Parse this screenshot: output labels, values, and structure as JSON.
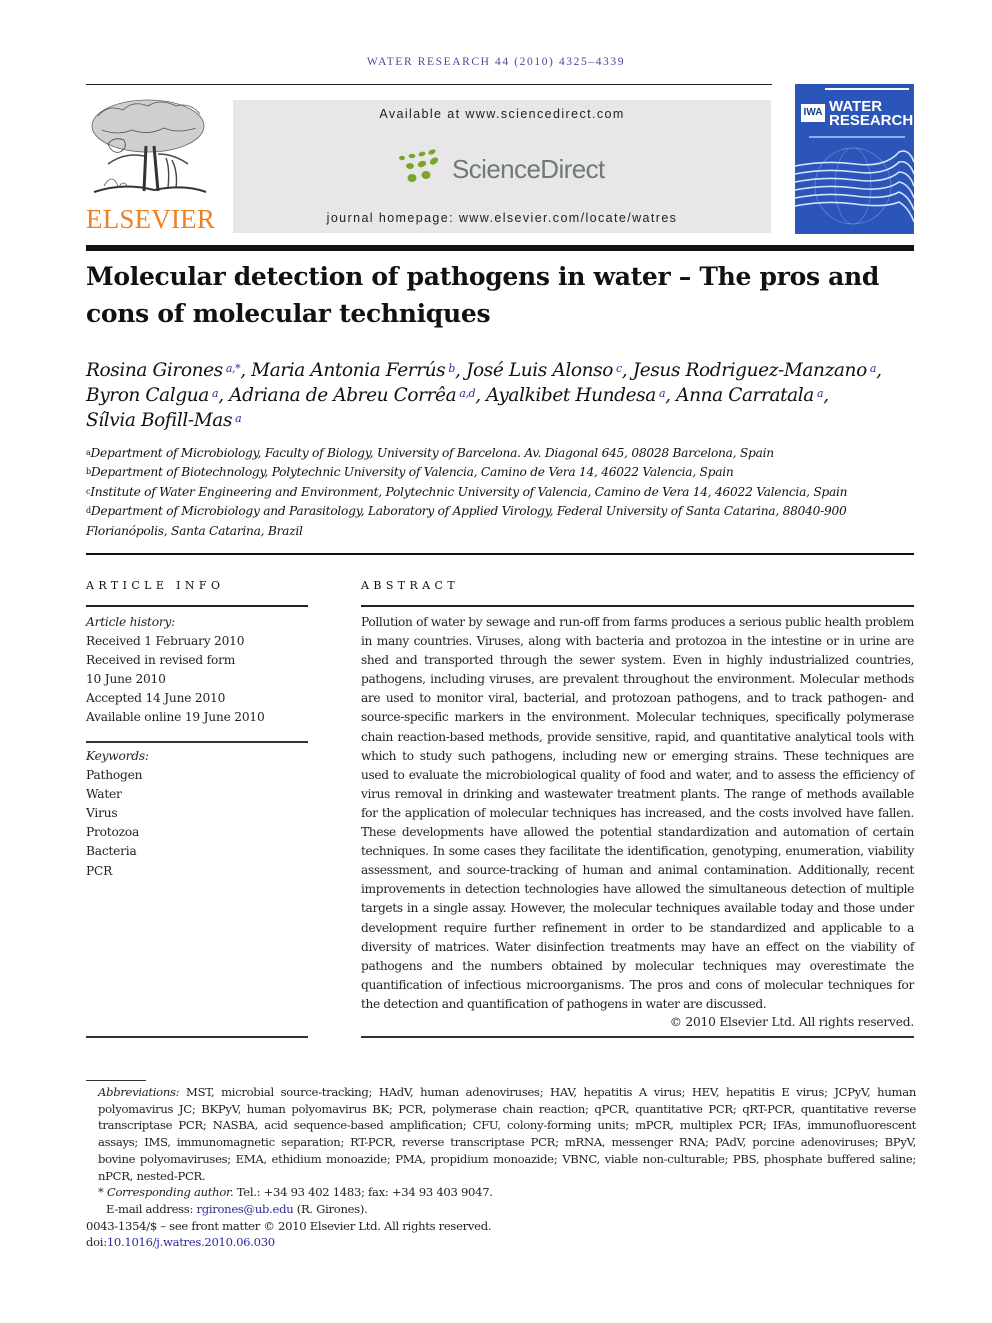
{
  "journal": {
    "running_head": "WATER RESEARCH 44 (2010) 4325–4339",
    "publisher_wordmark": "ELSEVIER",
    "available_at": "Available at www.sciencedirect.com",
    "platform_name": "ScienceDirect",
    "homepage": "journal homepage: www.elsevier.com/locate/watres",
    "cover_title_line1": "WATER",
    "cover_title_line2": "RESEARCH",
    "cover_badge": "IWA",
    "colors": {
      "elsevier_orange": "#f07f1e",
      "sciencedirect_green": "#7aa52a",
      "cover_blue": "#2b55b8",
      "link_blue": "#2a2a9a"
    }
  },
  "article": {
    "title": "Molecular detection of pathogens in water – The pros and cons of molecular techniques",
    "authors": [
      {
        "name": "Rosina Girones",
        "aff": "a,*"
      },
      {
        "name": "Maria Antonia Ferrús",
        "aff": "b"
      },
      {
        "name": "José Luis Alonso",
        "aff": "c"
      },
      {
        "name": "Jesus Rodriguez-Manzano",
        "aff": "a"
      },
      {
        "name": "Byron Calgua",
        "aff": "a"
      },
      {
        "name": "Adriana de Abreu Corrêa",
        "aff": "a,d"
      },
      {
        "name": "Ayalkibet Hundesa",
        "aff": "a"
      },
      {
        "name": "Anna Carratala",
        "aff": "a"
      },
      {
        "name": "Sílvia Bofill-Mas",
        "aff": "a"
      }
    ],
    "affiliations": [
      {
        "key": "a",
        "text": "Department of Microbiology, Faculty of Biology, University of Barcelona. Av. Diagonal 645, 08028 Barcelona, Spain"
      },
      {
        "key": "b",
        "text": "Department of Biotechnology, Polytechnic University of Valencia, Camino de Vera 14, 46022 Valencia, Spain"
      },
      {
        "key": "c",
        "text": "Institute of Water Engineering and Environment, Polytechnic University of Valencia, Camino de Vera 14, 46022 Valencia, Spain"
      },
      {
        "key": "d",
        "text": "Department of Microbiology and Parasitology, Laboratory of Applied Virology, Federal University of Santa Catarina, 88040-900 Florianópolis, Santa Catarina, Brazil"
      }
    ]
  },
  "article_info": {
    "heading": "ARTICLE INFO",
    "history_label": "Article history:",
    "history": [
      "Received 1 February 2010",
      "Received in revised form",
      "10 June 2010",
      "Accepted 14 June 2010",
      "Available online 19 June 2010"
    ],
    "keywords_label": "Keywords:",
    "keywords": [
      "Pathogen",
      "Water",
      "Virus",
      "Protozoa",
      "Bacteria",
      "PCR"
    ]
  },
  "abstract": {
    "heading": "ABSTRACT",
    "text": "Pollution of water by sewage and run-off from farms produces a serious public health problem in many countries. Viruses, along with bacteria and protozoa in the intestine or in urine are shed and transported through the sewer system. Even in highly industrialized countries, pathogens, including viruses, are prevalent throughout the environment. Molecular methods are used to monitor viral, bacterial, and protozoan pathogens, and to track pathogen- and source-specific markers in the environment. Molecular techniques, specifically polymerase chain reaction-based methods, provide sensitive, rapid, and quantitative analytical tools with which to study such pathogens, including new or emerging strains. These techniques are used to evaluate the microbiological quality of food and water, and to assess the efficiency of virus removal in drinking and wastewater treatment plants. The range of methods available for the application of molecular techniques has increased, and the costs involved have fallen. These developments have allowed the potential standardization and automation of certain techniques. In some cases they facilitate the identification, genotyping, enumeration, viability assessment, and source-tracking of human and animal contamination. Additionally, recent improvements in detection technologies have allowed the simultaneous detection of multiple targets in a single assay. However, the molecular techniques available today and those under development require further refinement in order to be standardized and applicable to a diversity of matrices. Water disinfection treatments may have an effect on the viability of pathogens and the numbers obtained by molecular techniques may overestimate the quantification of infectious microorganisms. The pros and cons of molecular techniques for the detection and quantification of pathogens in water are discussed.",
    "copyright": "© 2010 Elsevier Ltd. All rights reserved."
  },
  "footnotes": {
    "abbreviations_label": "Abbreviations:",
    "abbreviations": "MST, microbial source-tracking; HAdV, human adenoviruses; HAV, hepatitis A virus; HEV, hepatitis E virus; JCPyV, human polyomavirus JC; BKPyV, human polyomavirus BK; PCR, polymerase chain reaction; qPCR, quantitative PCR; qRT-PCR, quantitative reverse transcriptase PCR; NASBA, acid sequence-based amplification; CFU, colony-forming units; mPCR, multiplex PCR; IFAs, immunofluorescent assays; IMS, immunomagnetic separation; RT-PCR, reverse transcriptase PCR; mRNA, messenger RNA; PAdV, porcine adenoviruses; BPyV, bovine polyomaviruses; EMA, ethidium monoazide; PMA, propidium monoazide; VBNC, viable non-culturable; PBS, phosphate buffered saline; nPCR, nested-PCR.",
    "corresponding_mark": "*",
    "corresponding_label": "Corresponding author.",
    "corresponding_contact": "Tel.: +34 93 402 1483; fax: +34 93 403 9047.",
    "email_label": "E-mail address:",
    "email": "rgirones@ub.edu",
    "email_suffix": "(R. Girones).",
    "issn_line": "0043-1354/$ – see front matter © 2010 Elsevier Ltd. All rights reserved.",
    "doi_label": "doi:",
    "doi": "10.1016/j.watres.2010.06.030"
  }
}
